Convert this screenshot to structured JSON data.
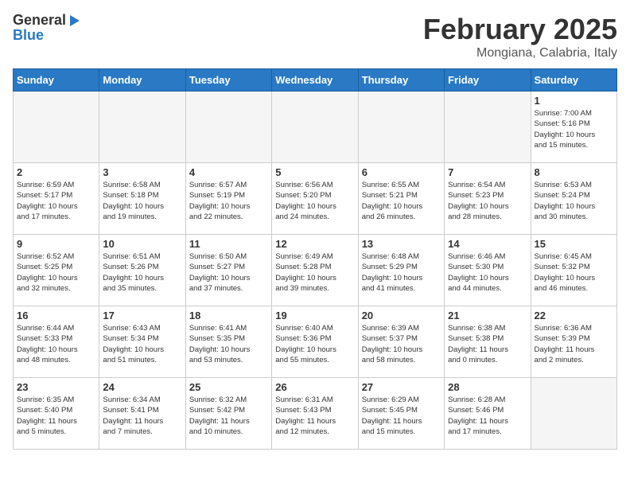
{
  "header": {
    "logo_general": "General",
    "logo_blue": "Blue",
    "title": "February 2025",
    "subtitle": "Mongiana, Calabria, Italy"
  },
  "weekdays": [
    "Sunday",
    "Monday",
    "Tuesday",
    "Wednesday",
    "Thursday",
    "Friday",
    "Saturday"
  ],
  "weeks": [
    [
      {
        "day": "",
        "info": ""
      },
      {
        "day": "",
        "info": ""
      },
      {
        "day": "",
        "info": ""
      },
      {
        "day": "",
        "info": ""
      },
      {
        "day": "",
        "info": ""
      },
      {
        "day": "",
        "info": ""
      },
      {
        "day": "1",
        "info": "Sunrise: 7:00 AM\nSunset: 5:16 PM\nDaylight: 10 hours\nand 15 minutes."
      }
    ],
    [
      {
        "day": "2",
        "info": "Sunrise: 6:59 AM\nSunset: 5:17 PM\nDaylight: 10 hours\nand 17 minutes."
      },
      {
        "day": "3",
        "info": "Sunrise: 6:58 AM\nSunset: 5:18 PM\nDaylight: 10 hours\nand 19 minutes."
      },
      {
        "day": "4",
        "info": "Sunrise: 6:57 AM\nSunset: 5:19 PM\nDaylight: 10 hours\nand 22 minutes."
      },
      {
        "day": "5",
        "info": "Sunrise: 6:56 AM\nSunset: 5:20 PM\nDaylight: 10 hours\nand 24 minutes."
      },
      {
        "day": "6",
        "info": "Sunrise: 6:55 AM\nSunset: 5:21 PM\nDaylight: 10 hours\nand 26 minutes."
      },
      {
        "day": "7",
        "info": "Sunrise: 6:54 AM\nSunset: 5:23 PM\nDaylight: 10 hours\nand 28 minutes."
      },
      {
        "day": "8",
        "info": "Sunrise: 6:53 AM\nSunset: 5:24 PM\nDaylight: 10 hours\nand 30 minutes."
      }
    ],
    [
      {
        "day": "9",
        "info": "Sunrise: 6:52 AM\nSunset: 5:25 PM\nDaylight: 10 hours\nand 32 minutes."
      },
      {
        "day": "10",
        "info": "Sunrise: 6:51 AM\nSunset: 5:26 PM\nDaylight: 10 hours\nand 35 minutes."
      },
      {
        "day": "11",
        "info": "Sunrise: 6:50 AM\nSunset: 5:27 PM\nDaylight: 10 hours\nand 37 minutes."
      },
      {
        "day": "12",
        "info": "Sunrise: 6:49 AM\nSunset: 5:28 PM\nDaylight: 10 hours\nand 39 minutes."
      },
      {
        "day": "13",
        "info": "Sunrise: 6:48 AM\nSunset: 5:29 PM\nDaylight: 10 hours\nand 41 minutes."
      },
      {
        "day": "14",
        "info": "Sunrise: 6:46 AM\nSunset: 5:30 PM\nDaylight: 10 hours\nand 44 minutes."
      },
      {
        "day": "15",
        "info": "Sunrise: 6:45 AM\nSunset: 5:32 PM\nDaylight: 10 hours\nand 46 minutes."
      }
    ],
    [
      {
        "day": "16",
        "info": "Sunrise: 6:44 AM\nSunset: 5:33 PM\nDaylight: 10 hours\nand 48 minutes."
      },
      {
        "day": "17",
        "info": "Sunrise: 6:43 AM\nSunset: 5:34 PM\nDaylight: 10 hours\nand 51 minutes."
      },
      {
        "day": "18",
        "info": "Sunrise: 6:41 AM\nSunset: 5:35 PM\nDaylight: 10 hours\nand 53 minutes."
      },
      {
        "day": "19",
        "info": "Sunrise: 6:40 AM\nSunset: 5:36 PM\nDaylight: 10 hours\nand 55 minutes."
      },
      {
        "day": "20",
        "info": "Sunrise: 6:39 AM\nSunset: 5:37 PM\nDaylight: 10 hours\nand 58 minutes."
      },
      {
        "day": "21",
        "info": "Sunrise: 6:38 AM\nSunset: 5:38 PM\nDaylight: 11 hours\nand 0 minutes."
      },
      {
        "day": "22",
        "info": "Sunrise: 6:36 AM\nSunset: 5:39 PM\nDaylight: 11 hours\nand 2 minutes."
      }
    ],
    [
      {
        "day": "23",
        "info": "Sunrise: 6:35 AM\nSunset: 5:40 PM\nDaylight: 11 hours\nand 5 minutes."
      },
      {
        "day": "24",
        "info": "Sunrise: 6:34 AM\nSunset: 5:41 PM\nDaylight: 11 hours\nand 7 minutes."
      },
      {
        "day": "25",
        "info": "Sunrise: 6:32 AM\nSunset: 5:42 PM\nDaylight: 11 hours\nand 10 minutes."
      },
      {
        "day": "26",
        "info": "Sunrise: 6:31 AM\nSunset: 5:43 PM\nDaylight: 11 hours\nand 12 minutes."
      },
      {
        "day": "27",
        "info": "Sunrise: 6:29 AM\nSunset: 5:45 PM\nDaylight: 11 hours\nand 15 minutes."
      },
      {
        "day": "28",
        "info": "Sunrise: 6:28 AM\nSunset: 5:46 PM\nDaylight: 11 hours\nand 17 minutes."
      },
      {
        "day": "",
        "info": ""
      }
    ]
  ]
}
